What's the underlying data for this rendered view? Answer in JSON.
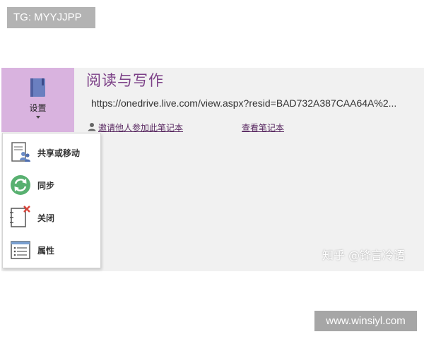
{
  "watermark_top": "TG: MYYJJPP",
  "watermark_bottom": "www.winsiyl.com",
  "watermark_zhihu": "知乎 @锋言冷语",
  "settings": {
    "label": "设置"
  },
  "notebook": {
    "title": "阅读与写作",
    "url": "https://onedrive.live.com/view.aspx?resid=BAD732A387CAA64A%2...",
    "invite_label": "邀请他人参加此笔记本",
    "view_label": "查看笔记本"
  },
  "menu": {
    "items": [
      {
        "label": "共享或移动",
        "icon": "share-move-icon"
      },
      {
        "label": "同步",
        "icon": "sync-icon"
      },
      {
        "label": "关闭",
        "icon": "close-notebook-icon"
      },
      {
        "label": "属性",
        "icon": "properties-icon"
      }
    ]
  },
  "colors": {
    "accent": "#7b3f86",
    "settings_bg": "#d9b3df",
    "panel_bg": "#f1f1f1"
  }
}
